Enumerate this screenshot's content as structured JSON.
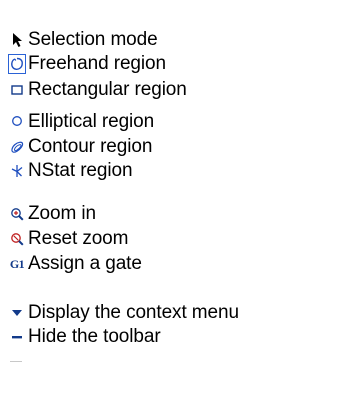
{
  "legend": {
    "items": [
      {
        "icon": "arrow-cursor-icon",
        "label": "Selection mode"
      },
      {
        "icon": "freehand-region-icon",
        "label": "Freehand region"
      },
      {
        "icon": "rectangle-region-icon",
        "label": "Rectangular region"
      },
      {
        "icon": "ellipse-region-icon",
        "label": "Elliptical region"
      },
      {
        "icon": "contour-region-icon",
        "label": "Contour region"
      },
      {
        "icon": "nstat-region-icon",
        "label": "NStat region"
      },
      {
        "icon": "zoom-in-icon",
        "label": "Zoom in"
      },
      {
        "icon": "reset-zoom-icon",
        "label": "Reset zoom"
      },
      {
        "icon": "gate-icon",
        "label": "Assign a gate",
        "icon_text": "G1"
      },
      {
        "icon": "context-menu-arrow-icon",
        "label": "Display the context menu"
      },
      {
        "icon": "hide-toolbar-icon",
        "label": "Hide the toolbar"
      }
    ]
  },
  "colors": {
    "icon_blue": "#1f4fbf",
    "icon_dark": "#123a8a",
    "icon_red": "#c02020",
    "icon_black": "#000000"
  }
}
